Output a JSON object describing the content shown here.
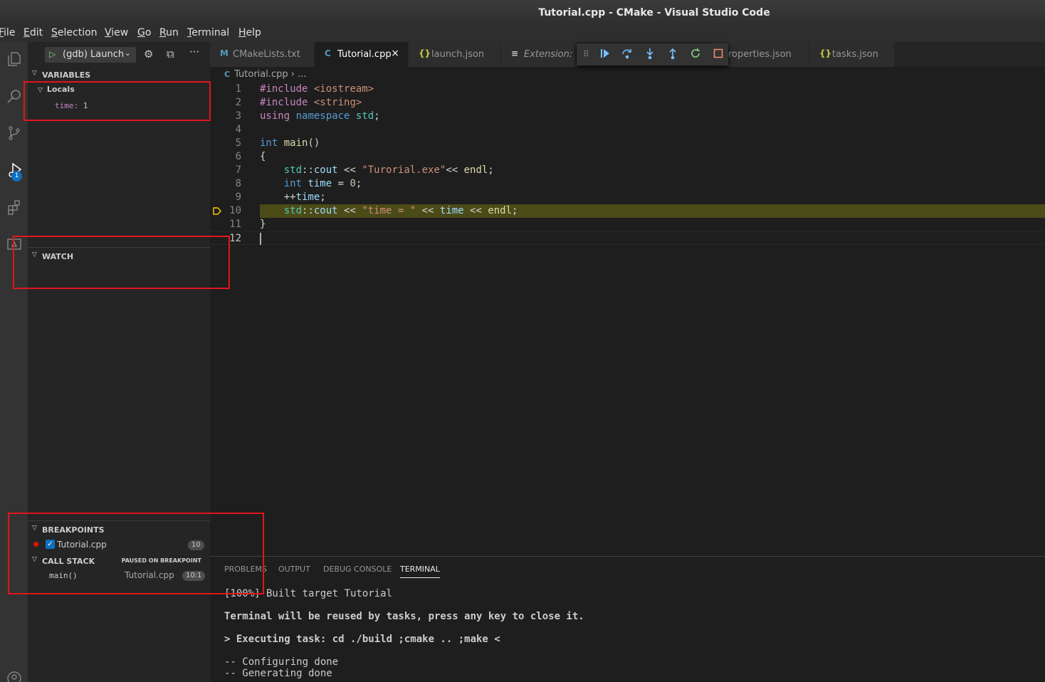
{
  "window": {
    "title": "Tutorial.cpp - CMake - Visual Studio Code"
  },
  "menu": [
    "File",
    "Edit",
    "Selection",
    "View",
    "Go",
    "Run",
    "Terminal",
    "Help"
  ],
  "activity_bar": {
    "icons": [
      "files-icon",
      "search-icon",
      "source-control-icon",
      "run-debug-icon",
      "extensions-icon",
      "remote-explorer-icon",
      "account-icon"
    ],
    "debug_badge": "1"
  },
  "debug_sidebar": {
    "launch_config": "(gdb) Launch",
    "variables": {
      "header": "VARIABLES",
      "locals_label": "Locals",
      "items": [
        {
          "name": "time",
          "value": "1"
        }
      ]
    },
    "watch": {
      "header": "WATCH"
    },
    "breakpoints": {
      "header": "BREAKPOINTS",
      "items": [
        {
          "file": "Tutorial.cpp",
          "line": "10",
          "checked": true
        }
      ]
    },
    "call_stack": {
      "header": "CALL STACK",
      "status": "PAUSED ON BREAKPOINT",
      "frames": [
        {
          "function": "main()",
          "file": "Tutorial.cpp",
          "position": "10:1"
        }
      ]
    }
  },
  "tabs": [
    {
      "label": "CMakeLists.txt",
      "icon": "M",
      "active": false,
      "italic": false
    },
    {
      "label": "Tutorial.cpp",
      "icon": "C",
      "active": true,
      "italic": false
    },
    {
      "label": "launch.json",
      "icon": "{}",
      "active": false,
      "italic": false
    },
    {
      "label": "Extension: C/",
      "icon": "≡",
      "active": false,
      "italic": true
    },
    {
      "label": "roperties.json",
      "icon": "",
      "active": false,
      "italic": false
    },
    {
      "label": "tasks.json",
      "icon": "{}",
      "active": false,
      "italic": false
    }
  ],
  "breadcrumb": {
    "file": "Tutorial.cpp",
    "rest": "..."
  },
  "editor": {
    "current_line": 10,
    "lines": [
      "#include <iostream>",
      "#include <string>",
      "using namespace std;",
      "",
      "int main()",
      "{",
      "    std::cout << \"Turorial.exe\"<< endl;",
      "    int time = 0;",
      "    ++time;",
      "    std::cout << \"time = \" << time << endl;",
      "}",
      ""
    ]
  },
  "panel": {
    "tabs": [
      "PROBLEMS",
      "OUTPUT",
      "DEBUG CONSOLE",
      "TERMINAL"
    ],
    "active_tab": "TERMINAL",
    "terminal_lines": [
      "[100%] Built target Tutorial",
      "Terminal will be reused by tasks, press any key to close it.",
      "> Executing task: cd ./build ;cmake .. ;make <",
      "-- Configuring done",
      "-- Generating done"
    ]
  },
  "colors": {
    "annotation_box": "#e0161a",
    "current_line_highlight": "#4b4b18",
    "breakpoint": "#e51400",
    "accent": "#0e70c0"
  }
}
